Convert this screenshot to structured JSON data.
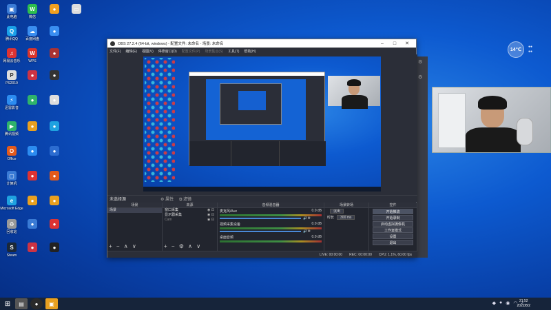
{
  "desktop_icons": [
    {
      "label": "此电脑",
      "icon": "computer-icon",
      "color": "#3a7bd5"
    },
    {
      "label": "腾讯QQ",
      "icon": "qq-icon",
      "color": "#1aa0e8"
    },
    {
      "label": "网易云音乐",
      "icon": "music-icon",
      "color": "#d33"
    },
    {
      "label": "PS2019",
      "icon": "ps-icon",
      "color": "#ddd"
    },
    {
      "label": "迅雷影音",
      "icon": "thunder-icon",
      "color": "#2c8cf0"
    },
    {
      "label": "腾讯视频",
      "icon": "video-icon",
      "color": "#2fb36b"
    },
    {
      "label": "Office",
      "icon": "office-icon",
      "color": "#e25a1c"
    },
    {
      "label": "计算机",
      "icon": "pc-icon",
      "color": "#3a7bd5"
    },
    {
      "label": "Microsoft Edge",
      "icon": "edge-icon",
      "color": "#1fa2e0"
    },
    {
      "label": "回收站",
      "icon": "recycle-icon",
      "color": "#999"
    },
    {
      "label": "Steam",
      "icon": "steam-icon",
      "color": "#1b2838"
    },
    {
      "label": "微信",
      "icon": "wechat-icon",
      "color": "#2dbd4e"
    },
    {
      "label": "百度网盘",
      "icon": "cloud-icon",
      "color": "#3a8ef0"
    },
    {
      "label": "WPS",
      "icon": "wps-icon",
      "color": "#d8342c"
    }
  ],
  "widget": {
    "value": "14℃",
    "line1": "●●",
    "line2": "●●"
  },
  "obs": {
    "title": "OBS 27.2.4 (64-bit, windows) - 配置文件: 未命名 - 场景: 未命名",
    "menus": [
      "文件(F)",
      "编辑(E)",
      "视图(V)",
      "停靠窗口(D)",
      "配置文件(P)",
      "场景集合(S)",
      "工具(T)",
      "帮助(H)"
    ],
    "no_source_selected": "未选择源",
    "properties_label": "属性",
    "filters_label": "滤镜",
    "docks": {
      "scenes": {
        "header": "场景",
        "items": [
          "场景"
        ]
      },
      "sources": {
        "header": "来源",
        "items": [
          "窗口采集",
          "显示器采集",
          "Cam"
        ]
      },
      "mixer": {
        "header": "音频混音器",
        "channels": [
          {
            "name": "麦克风/Aux",
            "db": "0.0 dB"
          },
          {
            "name": "视频采集设备",
            "db": "0.0 dB"
          },
          {
            "name": "桌面音频",
            "db": "0.0 dB"
          }
        ]
      },
      "transitions": {
        "header": "场景转场",
        "type": "淡出",
        "duration_label": "时长",
        "duration": "300 ms"
      },
      "controls": {
        "header": "控件",
        "buttons": [
          "开始推流",
          "开始录制",
          "启动虚拟摄像机",
          "工作室模式",
          "设置",
          "退出"
        ]
      }
    },
    "status": {
      "live": "LIVE: 00:00:00",
      "rec": "REC: 00:00:00",
      "cpu": "CPU: 1.1%, 60.00 fps"
    }
  },
  "taskbar": {
    "time": "21:52",
    "date": "2022/8/2"
  }
}
